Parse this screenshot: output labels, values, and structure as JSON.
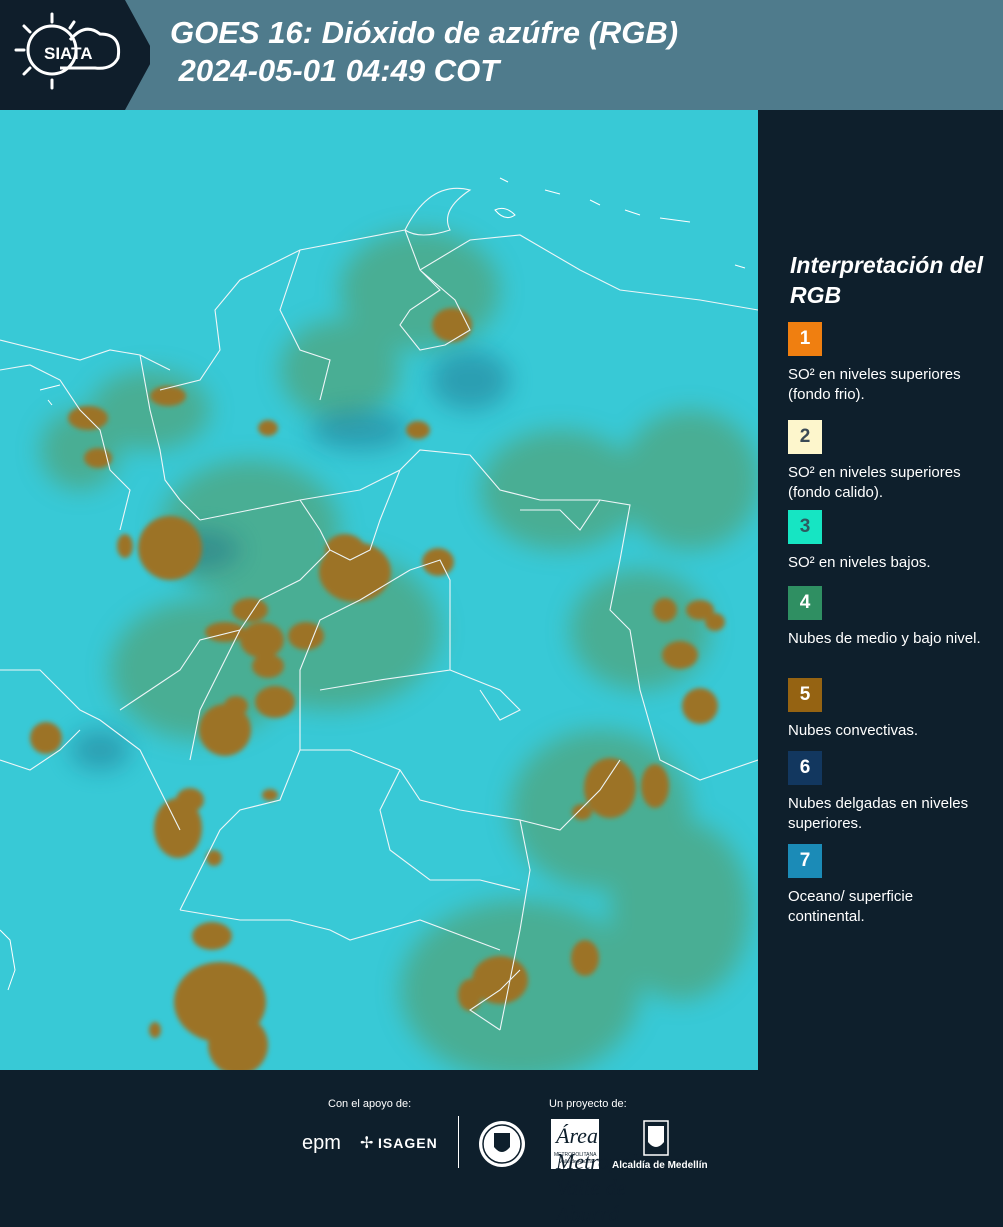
{
  "header": {
    "logo_text": "SIATA",
    "title": "GOES 16: Dióxido de azúfre (RGB)\n 2024-05-01 04:49 COT"
  },
  "legend": {
    "title": "Interpretación del RGB",
    "items": [
      {
        "number": "1",
        "label": "SO² en niveles superiores (fondo frio).",
        "color": "#f07f10",
        "number_color": "#ffffff"
      },
      {
        "number": "2",
        "label": "SO² en niveles superiores (fondo calido).",
        "color": "#fdf6cc",
        "number_color": "#3a4a55"
      },
      {
        "number": "3",
        "label": "SO² en niveles bajos.",
        "color": "#16e5c3",
        "number_color": "#2d5a60"
      },
      {
        "number": "4",
        "label": "Nubes de medio y bajo nivel.",
        "color": "#2f8f62",
        "number_color": "#ffffff"
      },
      {
        "number": "5",
        "label": "Nubes convectivas.",
        "color": "#956312",
        "number_color": "#ffffff"
      },
      {
        "number": "6",
        "label": "Nubes delgadas en niveles superiores.",
        "color": "#12375f",
        "number_color": "#ffffff"
      },
      {
        "number": "7",
        "label": "Oceano/ superficie continental.",
        "color": "#1b8bb7",
        "number_color": "#ffffff"
      }
    ]
  },
  "footer": {
    "support_label": "Con el apoyo de:",
    "project_label": "Un proyecto de:",
    "partners": [
      "epm",
      "ISAGEN",
      "Área Metropolitana Valle de Aburrá",
      "Alcaldía de Medellín"
    ],
    "partner_small": "METROPOLITANA",
    "partner_small2": "Valle de Aburrá"
  }
}
